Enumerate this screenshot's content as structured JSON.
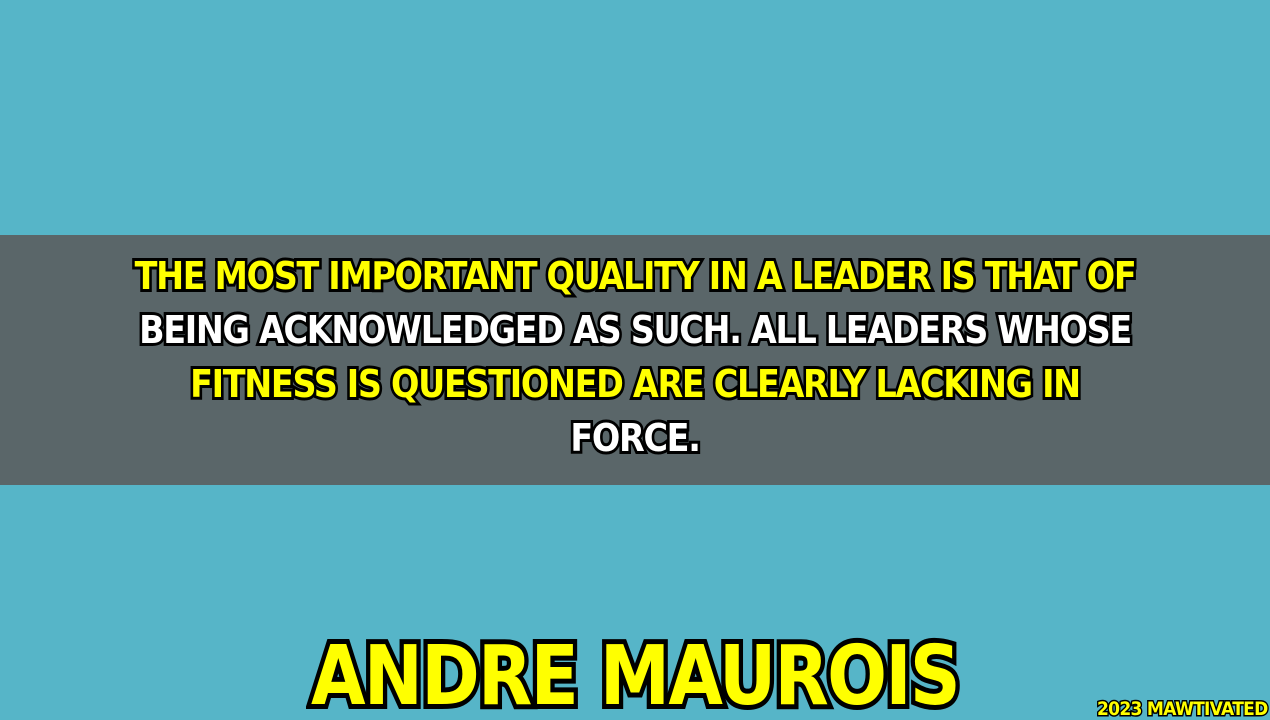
{
  "quote": {
    "lines": [
      "THE MOST IMPORTANT QUALITY IN A LEADER IS THAT OF",
      "BEING ACKNOWLEDGED AS SUCH. ALL LEADERS WHOSE",
      "FITNESS IS QUESTIONED ARE CLEARLY LACKING IN",
      "FORCE."
    ]
  },
  "author": "ANDRE MAUROIS",
  "watermark": "2023 MAWTIVATED",
  "colors": {
    "background": "#56b5c8",
    "band": "#5a6669",
    "accent": "#ffff00",
    "text_alt": "#ffffff",
    "outline": "#000000"
  }
}
